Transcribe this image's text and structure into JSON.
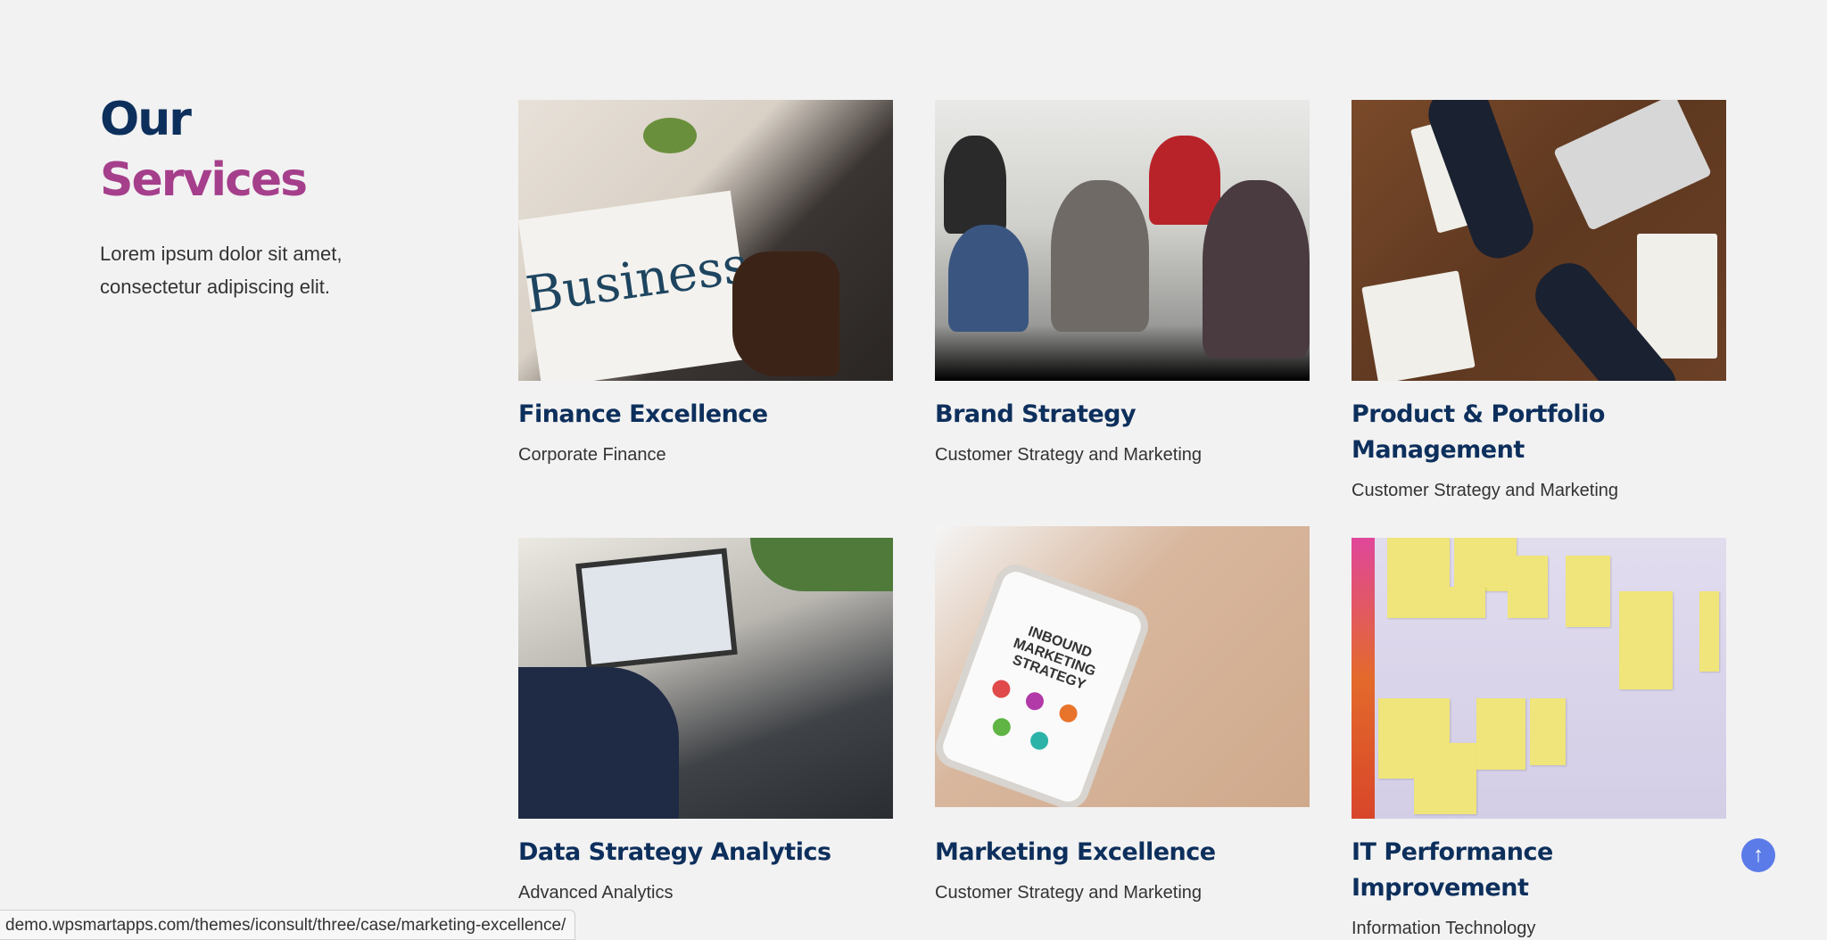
{
  "intro": {
    "title_line1": "Our",
    "title_line2": "Services",
    "description": "Lorem ipsum dolor sit amet, consectetur adipiscing elit."
  },
  "colors": {
    "navy": "#0d2f5c",
    "magenta": "#a53f8b",
    "background": "#f2f2f2",
    "scroll_button": "#5b7be8"
  },
  "services": [
    {
      "title": "Finance Excellence",
      "subtitle": "Corporate Finance",
      "image": "business-newspaper-photo"
    },
    {
      "title": "Brand Strategy",
      "subtitle": "Customer Strategy and Marketing",
      "image": "team-meeting-photo"
    },
    {
      "title": "Product & Portfolio Management",
      "subtitle": "Customer Strategy and Marketing",
      "image": "handshake-desk-photo"
    },
    {
      "title": "Data Strategy Analytics",
      "subtitle": "Advanced Analytics",
      "image": "laptop-analytics-photo"
    },
    {
      "title": "Marketing Excellence",
      "subtitle": "Customer Strategy and Marketing",
      "image": "phone-marketing-photo"
    },
    {
      "title": "IT Performance Improvement",
      "subtitle": "Information Technology",
      "image": "sticky-notes-board-photo"
    }
  ],
  "image_text": {
    "business_word": "Business",
    "phone_text": "INBOUND MARKETING STRATEGY"
  },
  "scroll_top": {
    "icon": "arrow-up-icon",
    "glyph": "↑"
  },
  "status_bar": {
    "url": "demo.wpsmartapps.com/themes/iconsult/three/case/marketing-excellence/"
  }
}
